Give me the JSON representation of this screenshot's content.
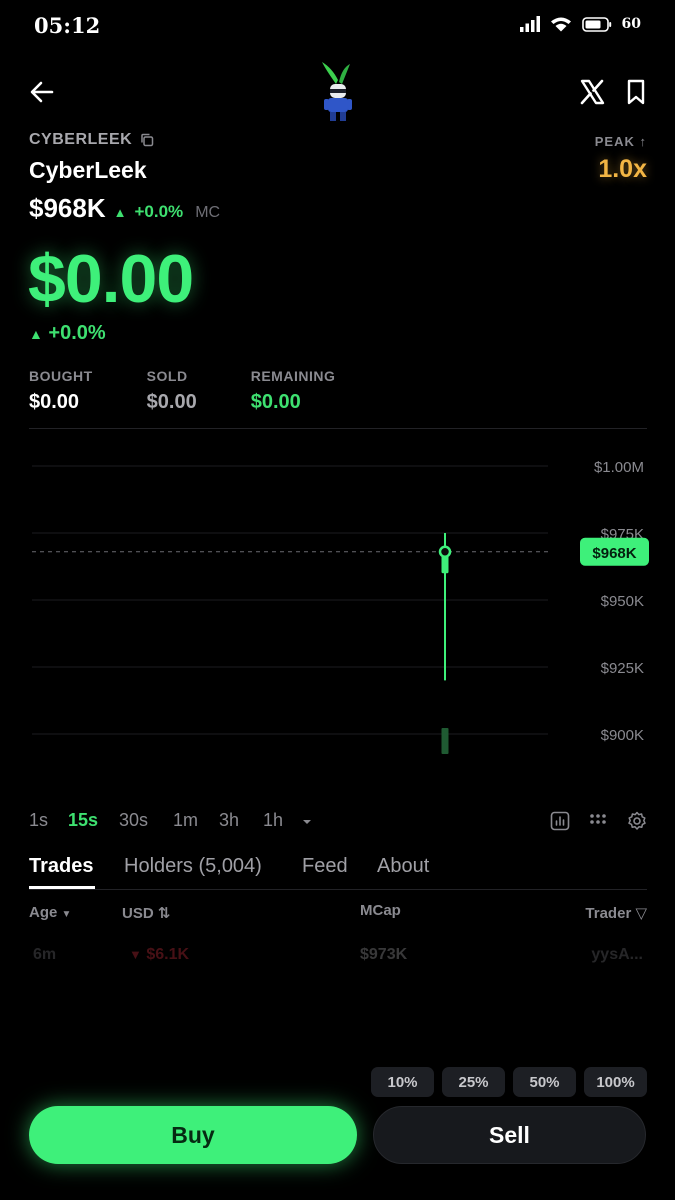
{
  "status_bar": {
    "time": "05:12",
    "battery": "60"
  },
  "token": {
    "ticker": "CYBERLEEK",
    "name": "CyberLeek",
    "market_cap": "$968K",
    "mc_change": "+0.0%",
    "mc_label": "MC",
    "peak_label": "PEAK ↑",
    "peak_value": "1.0x"
  },
  "position": {
    "value": "$0.00",
    "change": "+0.0%",
    "bought_label": "BOUGHT",
    "bought_value": "$0.00",
    "sold_label": "SOLD",
    "sold_value": "$0.00",
    "remaining_label": "REMAINING",
    "remaining_value": "$0.00"
  },
  "chart_data": {
    "type": "candlestick",
    "y_ticks": [
      "$1.00M",
      "$975K",
      "$950K",
      "$925K",
      "$900K"
    ],
    "current_price_label": "$968K",
    "current_price": 968000,
    "candles": [
      {
        "open": 960000,
        "close": 968000,
        "high": 975000,
        "low": 920000
      }
    ],
    "volume": [
      0.2
    ],
    "colors": {
      "up": "#3ef07a",
      "grid": "#1c1c1f"
    }
  },
  "intervals": {
    "options": [
      "1s",
      "15s",
      "30s",
      "1m",
      "3h",
      "1h"
    ],
    "selected": "15s"
  },
  "tabs": {
    "trades": "Trades",
    "holders": "Holders (5,004)",
    "feed": "Feed",
    "about": "About"
  },
  "table": {
    "headers": {
      "age": "Age",
      "usd": "USD",
      "mcap": "MCap",
      "trader": "Trader"
    },
    "rows": [
      {
        "age": "6m",
        "usd": "$6.1K",
        "mcap": "$973K",
        "trader": "yysA..."
      }
    ]
  },
  "quick_amounts": [
    "10%",
    "25%",
    "50%",
    "100%"
  ],
  "actions": {
    "buy": "Buy",
    "sell": "Sell"
  }
}
